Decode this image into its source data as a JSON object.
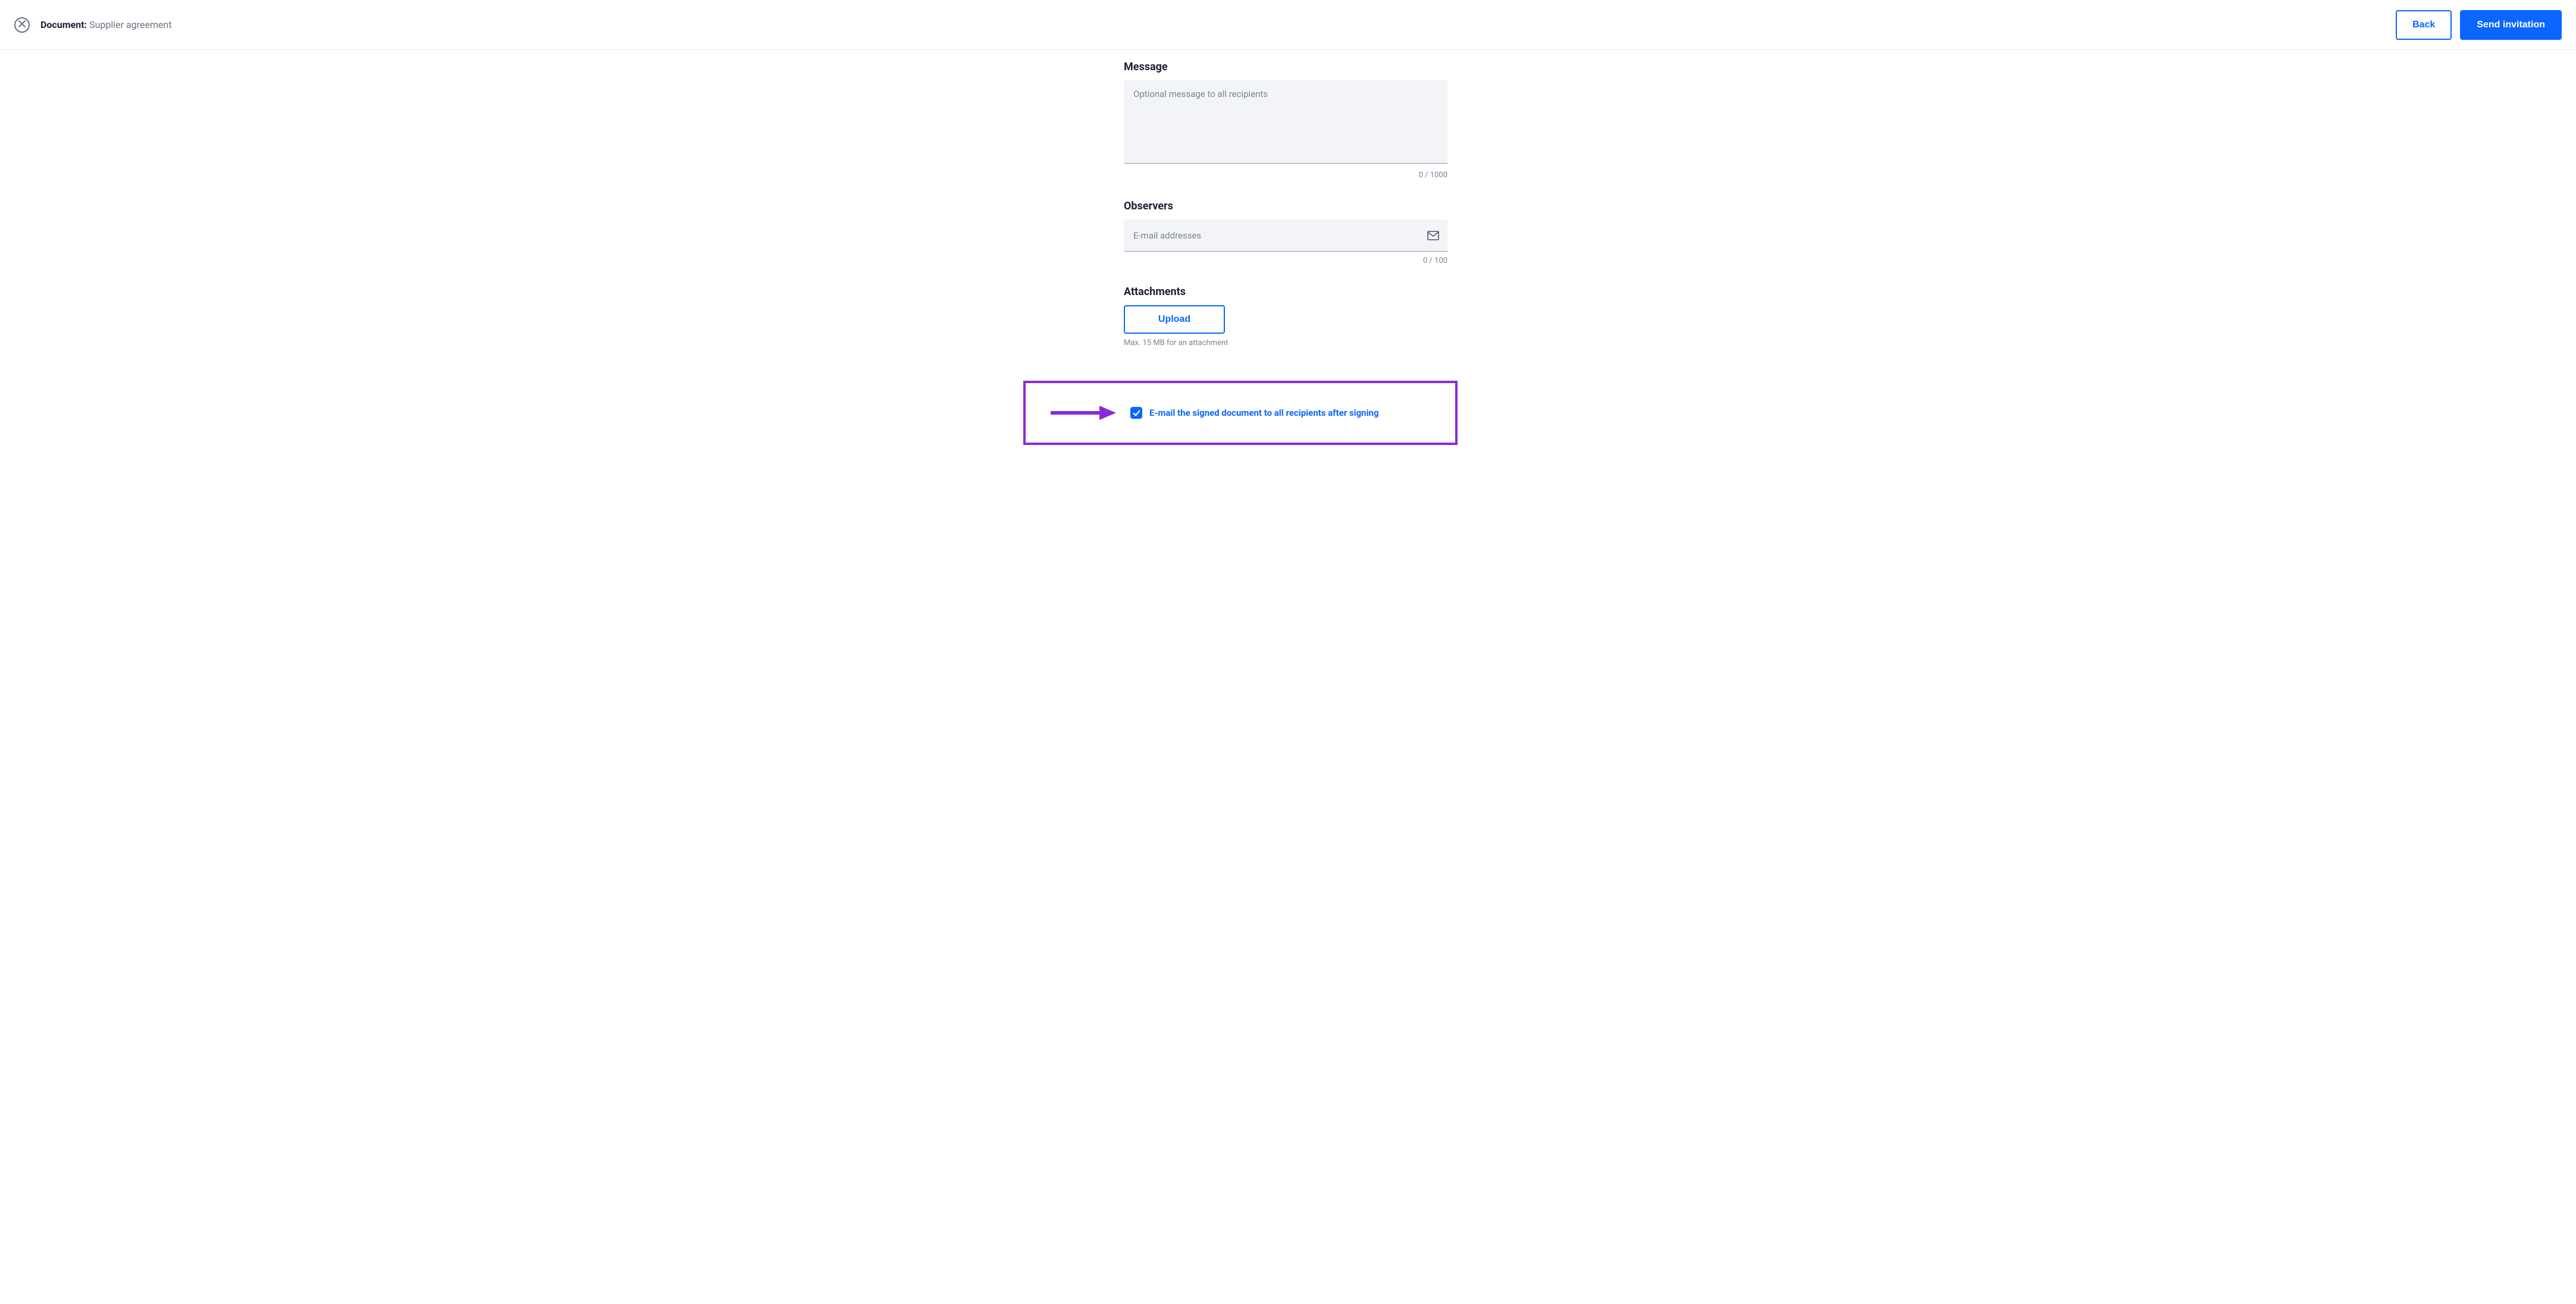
{
  "header": {
    "doc_label": "Document:",
    "doc_name": "Supplier agreement",
    "back_label": "Back",
    "send_label": "Send invitation"
  },
  "message": {
    "title": "Message",
    "placeholder": "Optional message to all recipients",
    "value": "",
    "counter": "0 / 1000"
  },
  "observers": {
    "title": "Observers",
    "placeholder": "E-mail addresses",
    "value": "",
    "counter": "0 / 100"
  },
  "attachments": {
    "title": "Attachments",
    "upload_label": "Upload",
    "hint": "Max. 15 MB for an attachment"
  },
  "email_option": {
    "checked": true,
    "label": "E-mail the signed document to all recipients after signing"
  },
  "colors": {
    "primary": "#0a66ff",
    "highlight": "#8a2bd9"
  }
}
